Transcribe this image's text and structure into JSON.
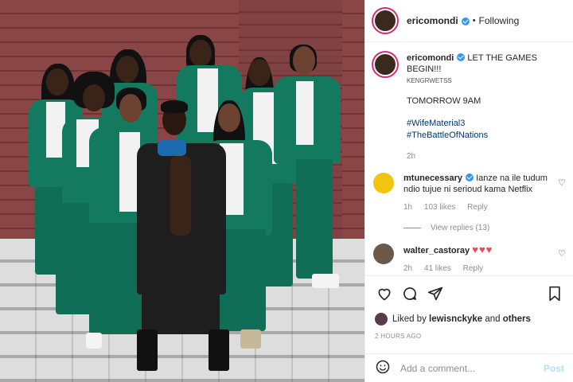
{
  "post": {
    "username": "ericomondi",
    "follow_status": "Following",
    "separator": "•"
  },
  "caption": {
    "username": "ericomondi",
    "text": "LET THE GAMES BEGIN!!!",
    "subtext": "KENGRWETSS",
    "line2": "TOMORROW 9AM",
    "hashtags": [
      "#WifeMaterial3",
      "#TheBattleOfNations"
    ],
    "age": "2h"
  },
  "comments": [
    {
      "username": "mtunecessary",
      "text": "Ianze na ile tudum ndio tujue ni serioud kama Netflix",
      "age": "1h",
      "likes": "103 likes",
      "reply": "Reply",
      "view_replies": "View replies (13)"
    },
    {
      "username": "walter_castoray",
      "text": "♥♥♥",
      "age": "2h",
      "likes": "41 likes",
      "reply": "Reply"
    }
  ],
  "likes": {
    "prefix": "Liked by",
    "user": "lewisnckyke",
    "joiner": "and",
    "others": "others"
  },
  "timestamp": "2 HOURS AGO",
  "add_comment": {
    "placeholder": "Add a comment...",
    "post_label": "Post"
  },
  "colors": {
    "verified": "#3897f0",
    "hashtag": "#00376b",
    "post_button": "#b2dffc",
    "heart": "#ed4956",
    "story_ring": "#d62976"
  },
  "icons": {
    "verified": "verified-badge-icon",
    "like": "heart-icon",
    "comment": "comment-bubble-icon",
    "share": "paper-plane-icon",
    "save": "bookmark-icon",
    "emoji": "emoji-smile-icon"
  }
}
